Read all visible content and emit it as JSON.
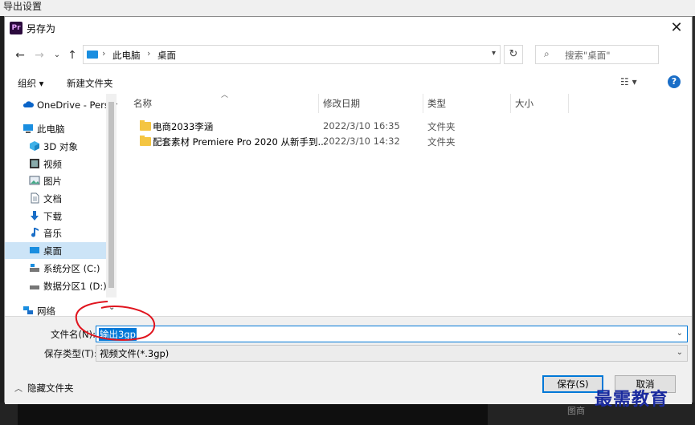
{
  "background": {
    "window_title": "导出设置",
    "side_caption": "图商"
  },
  "dialog": {
    "app_icon": "Pr",
    "title": "另存为",
    "close": "✕"
  },
  "address": {
    "back": "←",
    "forward": "→",
    "recent": "⌄",
    "up": "↑",
    "path": [
      "此电脑",
      "桌面"
    ],
    "separator": "›",
    "refresh": "↻",
    "search_placeholder": "搜索\"桌面\""
  },
  "toolbar": {
    "organize": "组织 ▾",
    "new_folder": "新建文件夹",
    "view": "☷ ▾",
    "help": "?"
  },
  "sidebar": {
    "items": [
      {
        "label": "OneDrive - Personal",
        "icon": "cloud-icon"
      },
      {
        "label": "此电脑",
        "icon": "computer-icon"
      },
      {
        "label": "3D 对象",
        "icon": "cube-icon"
      },
      {
        "label": "视频",
        "icon": "video-icon"
      },
      {
        "label": "图片",
        "icon": "picture-icon"
      },
      {
        "label": "文档",
        "icon": "document-icon"
      },
      {
        "label": "下载",
        "icon": "download-icon"
      },
      {
        "label": "音乐",
        "icon": "music-icon"
      },
      {
        "label": "桌面",
        "icon": "desktop-icon",
        "selected": true
      },
      {
        "label": "系统分区 (C:)",
        "icon": "drive-icon"
      },
      {
        "label": "数据分区1 (D:)",
        "icon": "drive-icon"
      },
      {
        "label": "网络",
        "icon": "network-icon"
      }
    ]
  },
  "filelist": {
    "columns": [
      "名称",
      "修改日期",
      "类型",
      "大小"
    ],
    "rows": [
      {
        "name": "电商2033李涵",
        "date": "2022/3/10 16:35",
        "type": "文件夹"
      },
      {
        "name": "配套素材 Premiere Pro 2020 从新手到...",
        "date": "2022/3/10 14:32",
        "type": "文件夹"
      }
    ]
  },
  "form": {
    "filename_label": "文件名(N):",
    "filename_value": "输出3gp",
    "filetype_label": "保存类型(T):",
    "filetype_value": "视频文件(*.3gp)"
  },
  "footer": {
    "hide_folders": "隐藏文件夹",
    "save": "保存(S)",
    "cancel": "取消"
  },
  "watermark": "最需教育",
  "colors": {
    "accent": "#0078d7",
    "selection": "#cce4f7",
    "annotation": "#e0141e"
  }
}
